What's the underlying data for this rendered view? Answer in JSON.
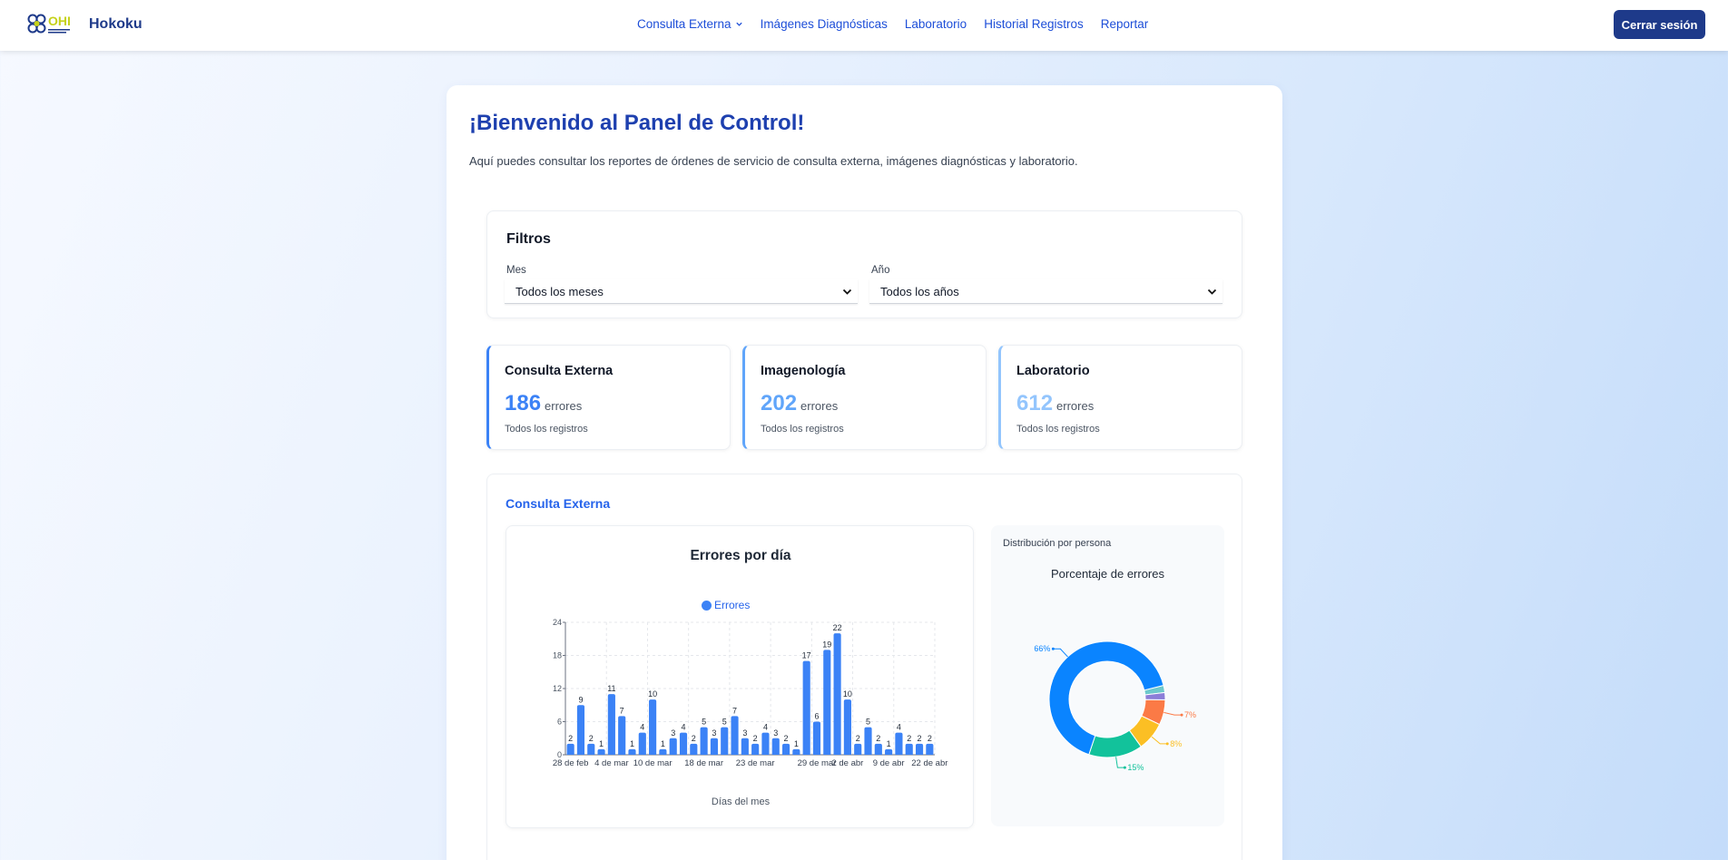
{
  "app": {
    "brand": "Hokoku",
    "logo_text": "OHI",
    "nav": [
      {
        "label": "Consulta Externa"
      },
      {
        "label": "Imágenes Diagnósticas"
      },
      {
        "label": "Laboratorio"
      },
      {
        "label": "Historial Registros"
      },
      {
        "label": "Reportar"
      }
    ],
    "logout_label": "Cerrar sesión"
  },
  "main": {
    "title": "¡Bienvenido al Panel de Control!",
    "intro": "Aquí puedes consultar los reportes de órdenes de servicio de consulta externa, imágenes diagnósticas y laboratorio."
  },
  "filters": {
    "title": "Filtros",
    "month_label": "Mes",
    "month_value": "Todos los meses",
    "year_label": "Año",
    "year_value": "Todos los años"
  },
  "stats": [
    {
      "title": "Consulta Externa",
      "value": "186",
      "unit": "errores",
      "sub": "Todos los registros",
      "color": "#3b82f6"
    },
    {
      "title": "Imagenología",
      "value": "202",
      "unit": "errores",
      "sub": "Todos los registros",
      "color": "#60a5fa"
    },
    {
      "title": "Laboratorio",
      "value": "612",
      "unit": "errores",
      "sub": "Todos los registros",
      "color": "#93c5fd"
    }
  ],
  "section": {
    "title": "Consulta Externa",
    "chart_title": "Errores por día",
    "legend": "Errores",
    "xlabel": "Días del mes",
    "pie_subtitle": "Distribución por persona",
    "pie_title": "Porcentaje de errores"
  },
  "colors": {
    "primary": "#1e3a8a",
    "bar": "#3b82f6"
  },
  "chart_data": [
    {
      "type": "bar",
      "title": "Errores por día",
      "xlabel": "Días del mes",
      "ylabel": "",
      "ylim": [
        0,
        24
      ],
      "yticks": [
        0,
        6,
        12,
        18,
        24
      ],
      "grid": true,
      "legend": "top-center",
      "series": [
        {
          "name": "Errores",
          "values": [
            2,
            9,
            2,
            1,
            11,
            7,
            1,
            4,
            10,
            1,
            3,
            4,
            2,
            5,
            3,
            5,
            7,
            3,
            2,
            4,
            3,
            2,
            1,
            17,
            6,
            19,
            22,
            10,
            2,
            5,
            2,
            1,
            4,
            2,
            2,
            2
          ]
        }
      ],
      "tick_labels": [
        "28 de feb",
        "4 de mar",
        "10 de mar",
        "18 de mar",
        "23 de mar",
        "29 de mar",
        "2 de abr",
        "9 de abr",
        "22 de abr"
      ],
      "tick_positions": [
        0,
        4,
        8,
        13,
        18,
        24,
        27,
        31,
        35
      ]
    },
    {
      "type": "pie",
      "title": "Porcentaje de errores",
      "donut": true,
      "slices": [
        {
          "value": 66,
          "label": "66%",
          "color": "#0a84ff"
        },
        {
          "value": 15,
          "label": "15%",
          "color": "#12c29b"
        },
        {
          "value": 8,
          "label": "8%",
          "color": "#fbbf24"
        },
        {
          "value": 7,
          "label": "7%",
          "color": "#fb7a46"
        },
        {
          "value": 2,
          "label": "",
          "color": "#8b7ed8"
        },
        {
          "value": 2,
          "label": "",
          "color": "#6ec9cc"
        }
      ]
    }
  ]
}
